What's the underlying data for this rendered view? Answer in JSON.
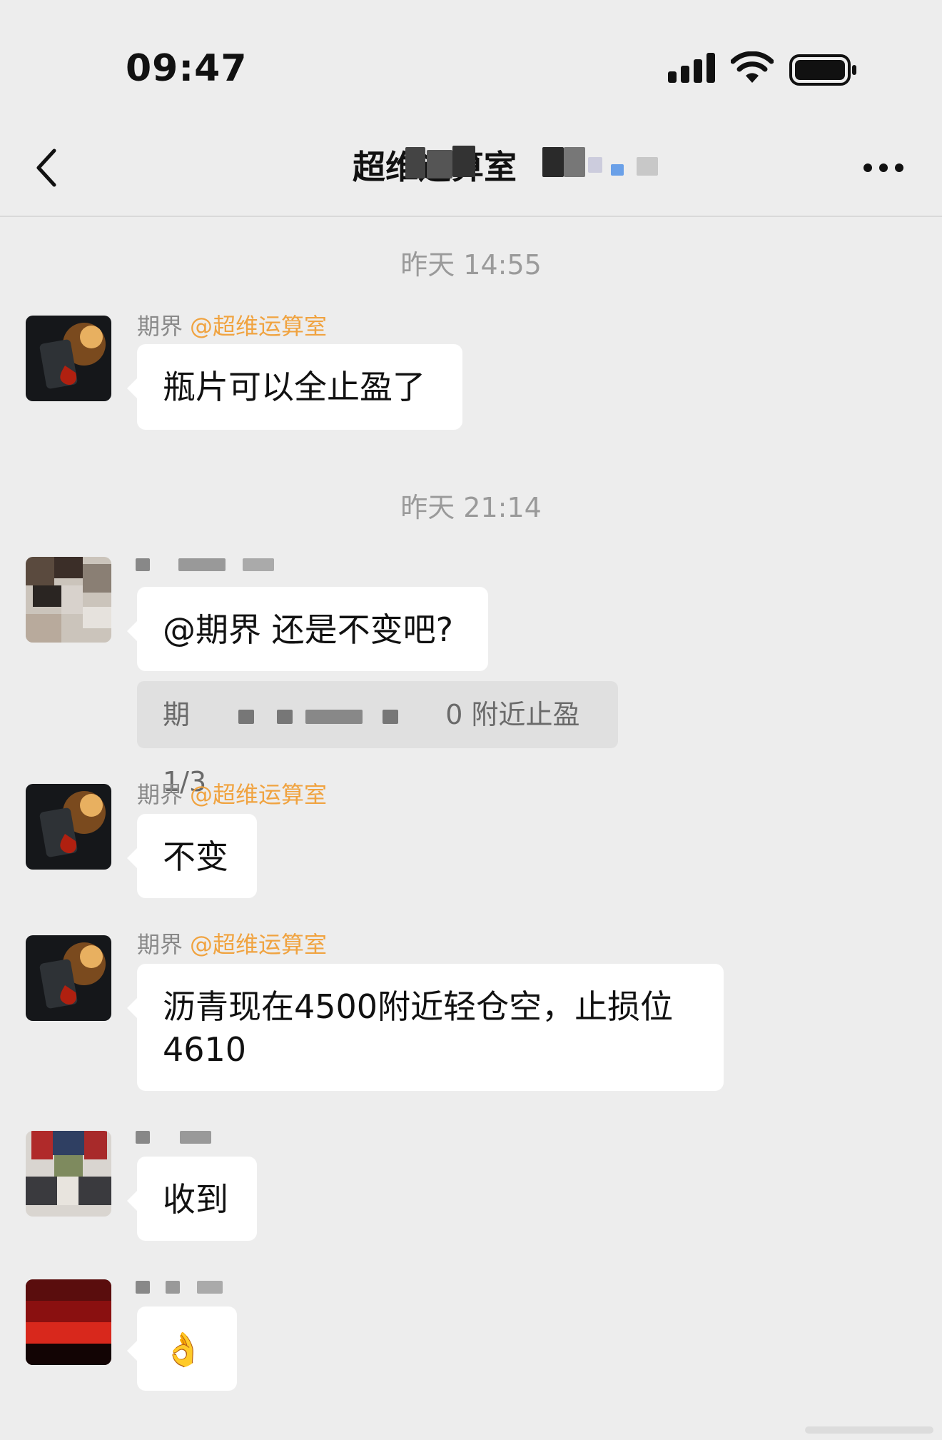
{
  "status_bar": {
    "time": "09:47",
    "icons": [
      "signal-icon",
      "wifi-icon",
      "battery-icon"
    ]
  },
  "nav": {
    "title": "超维运算室",
    "back_icon": "chevron-left-icon",
    "more_icon": "more-icon"
  },
  "colors": {
    "background": "#ededed",
    "bubble": "#ffffff",
    "mention": "#f0a340",
    "timestamp": "#9a9a9a",
    "quote_bg": "#e0e0e0"
  },
  "messages": {
    "ts1": "昨天 14:55",
    "m1": {
      "sender": "期界",
      "mention": "@超维运算室",
      "text": "瓶片可以全止盈了"
    },
    "ts2": "昨天 21:14",
    "m2": {
      "text": "@期界 还是不变吧?",
      "quote_prefix": "期",
      "quote_suffix": "0 附近止盈 1/3"
    },
    "m3": {
      "sender": "期界",
      "mention": "@超维运算室",
      "text": "不变"
    },
    "m4": {
      "sender": "期界",
      "mention": "@超维运算室",
      "line1": "沥青现在4500附近轻仓空，止损位",
      "line2": "4610"
    },
    "m5": {
      "text": "收到"
    },
    "m6": {
      "emoji": "👌"
    }
  }
}
